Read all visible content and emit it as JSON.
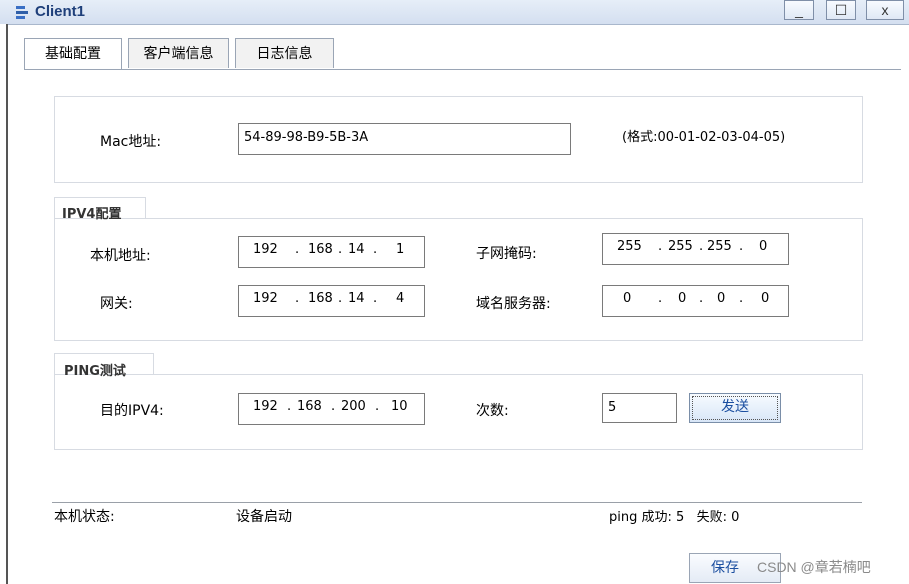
{
  "window": {
    "title": "Client1",
    "min_glyph": "_",
    "max_glyph": "☐",
    "close_glyph": "x"
  },
  "tabs": [
    {
      "label": "基础配置",
      "active": true
    },
    {
      "label": "客户端信息",
      "active": false
    },
    {
      "label": "日志信息",
      "active": false
    }
  ],
  "mac": {
    "label": "Mac地址:",
    "value": "54-89-98-B9-5B-3A",
    "hint": "(格式:00-01-02-03-04-05)"
  },
  "ipv4": {
    "legend": "IPV4配置",
    "local_label": "本机地址:",
    "local": [
      "192",
      "168",
      "14",
      "1"
    ],
    "mask_label": "子网掩码:",
    "mask": [
      "255",
      "255",
      "255",
      "0"
    ],
    "gateway_label": "网关:",
    "gateway": [
      "192",
      "168",
      "14",
      "4"
    ],
    "dns_label": "域名服务器:",
    "dns": [
      "0",
      "0",
      "0",
      "0"
    ]
  },
  "ping": {
    "legend": "PING测试",
    "target_label": "目的IPV4:",
    "target": [
      "192",
      "168",
      "200",
      "10"
    ],
    "count_label": "次数:",
    "count": "5",
    "send_label": "发送"
  },
  "status": {
    "label": "本机状态:",
    "value": "设备启动",
    "ping_result": "ping 成功: 5   失败: 0"
  },
  "save_label": "保存",
  "watermark": "CSDN @章若楠吧",
  "colors": {
    "title": "#1e3f7a",
    "button_text": "#1c4fa0"
  }
}
